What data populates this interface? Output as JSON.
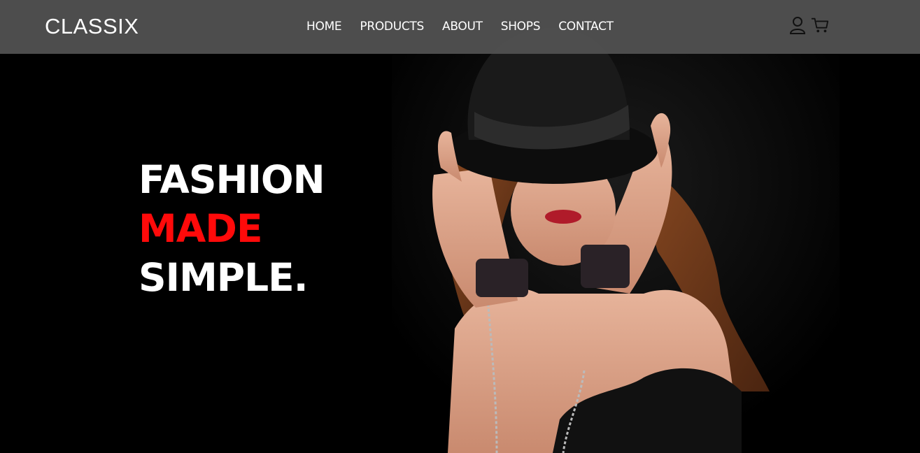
{
  "brand": {
    "name": "CLASSIX"
  },
  "nav": {
    "items": [
      {
        "label": "HOME"
      },
      {
        "label": "PRODUCTS"
      },
      {
        "label": "ABOUT"
      },
      {
        "label": "SHOPS"
      },
      {
        "label": "CONTACT"
      }
    ],
    "icons": [
      {
        "name": "user-icon"
      },
      {
        "name": "cart-icon"
      }
    ]
  },
  "hero": {
    "headline": {
      "line1": "FASHION",
      "line2": "MADE",
      "line3": "SIMPLE."
    }
  },
  "colors": {
    "background": "#000000",
    "navbar": "#505050",
    "text": "#ffffff",
    "accent": "#ff0a0a"
  }
}
